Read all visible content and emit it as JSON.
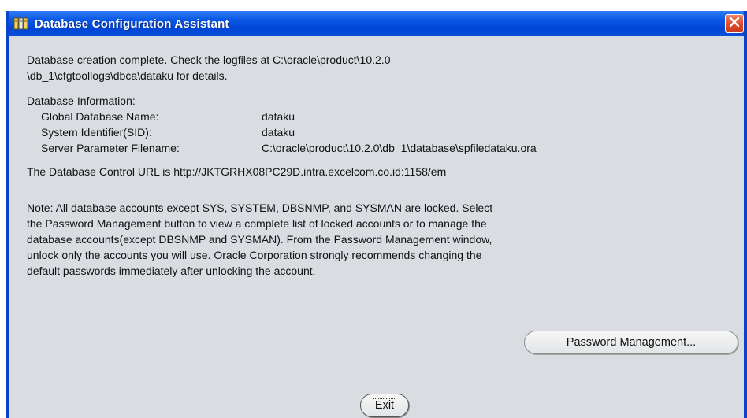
{
  "window": {
    "title": "Database Configuration Assistant",
    "title_icon": "database-app-icon",
    "close_icon": "close-icon",
    "titlebar_color": "#0a58e2",
    "close_color": "#e0492a"
  },
  "message": {
    "completion_line1": "Database creation complete. Check the logfiles at C:\\oracle\\product\\10.2.0",
    "completion_line2": "\\db_1\\cfgtoollogs\\dbca\\dataku for details.",
    "info_heading": "Database Information:",
    "info": [
      {
        "label": "Global Database Name:",
        "value": "dataku"
      },
      {
        "label": "System Identifier(SID):",
        "value": "dataku"
      },
      {
        "label": "Server Parameter Filename:",
        "value": "C:\\oracle\\product\\10.2.0\\db_1\\database\\spfiledataku.ora"
      }
    ],
    "control_url": "The Database Control URL is http://JKTGRHX08PC29D.intra.excelcom.co.id:1158/em",
    "note_lines": [
      "Note: All database accounts except SYS, SYSTEM, DBSNMP, and SYSMAN are locked. Select",
      "the Password Management button to view a complete list of locked accounts or to manage the",
      "database accounts(except DBSNMP and SYSMAN). From the Password Management window,",
      "unlock only the accounts you will use. Oracle Corporation strongly recommends changing the",
      "default passwords immediately after unlocking the account."
    ]
  },
  "buttons": {
    "password_management": "Password Management...",
    "exit": "Exit"
  }
}
